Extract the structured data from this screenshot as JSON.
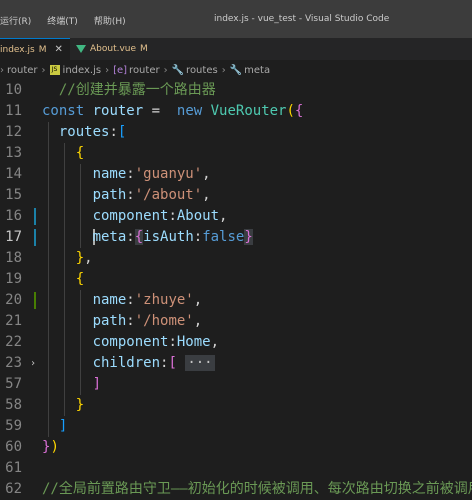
{
  "window": {
    "menus": [
      "运行(R)",
      "终端(T)",
      "帮助(H)"
    ],
    "title": "index.js - vue_test - Visual Studio Code"
  },
  "tabs": [
    {
      "name": "index.js",
      "status": "M",
      "active": true
    },
    {
      "name": "About.vue",
      "status": "M",
      "active": false
    }
  ],
  "breadcrumb": [
    "router",
    "index.js",
    "router",
    "routes",
    "meta"
  ],
  "editor": {
    "lines": [
      {
        "n": "10",
        "text": "  //创建并暴露一个路由器"
      },
      {
        "n": "11",
        "text": "const router =  new VueRouter({"
      },
      {
        "n": "12",
        "text": "  routes:["
      },
      {
        "n": "13",
        "text": "    {"
      },
      {
        "n": "14",
        "text": "      name:'guanyu',"
      },
      {
        "n": "15",
        "text": "      path:'/about',"
      },
      {
        "n": "16",
        "text": "      component:About,"
      },
      {
        "n": "17",
        "text": "      meta:{isAuth:false}"
      },
      {
        "n": "18",
        "text": "    },"
      },
      {
        "n": "19",
        "text": "    {"
      },
      {
        "n": "20",
        "text": "      name:'zhuye',"
      },
      {
        "n": "21",
        "text": "      path:'/home',"
      },
      {
        "n": "22",
        "text": "      component:Home,"
      },
      {
        "n": "23",
        "text": "      children:[ ···"
      },
      {
        "n": "57",
        "text": "      ]"
      },
      {
        "n": "58",
        "text": "    }"
      },
      {
        "n": "59",
        "text": "  ]"
      },
      {
        "n": "60",
        "text": "})"
      },
      {
        "n": "61",
        "text": ""
      },
      {
        "n": "62",
        "text": "//全局前置路由守卫——初始化的时候被调用、每次路由切换之前被调用"
      }
    ],
    "current_line": "17"
  }
}
